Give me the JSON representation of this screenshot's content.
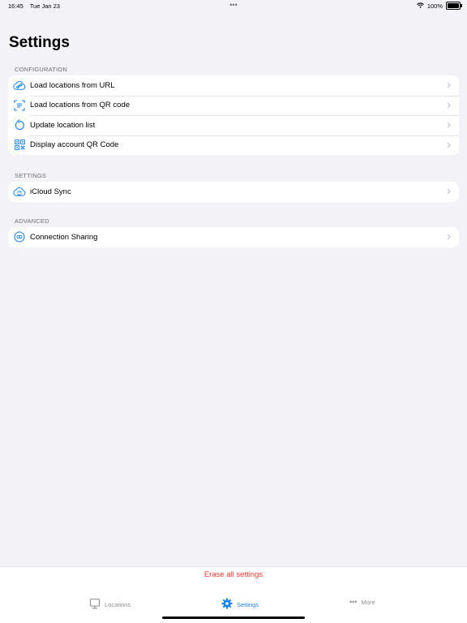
{
  "status_bar": {
    "time": "16:45",
    "date": "Tue Jan 23",
    "battery": "100%",
    "battery_level": 1.0
  },
  "page_title": "Settings",
  "sections": {
    "configuration": {
      "header": "CONFIGURATION",
      "items": [
        {
          "label": "Load locations from URL",
          "icon": "link-icon"
        },
        {
          "label": "Load locations from QR code",
          "icon": "qr-scan-icon"
        },
        {
          "label": "Update location list",
          "icon": "refresh-icon"
        },
        {
          "label": "Display account QR Code",
          "icon": "qr-code-icon"
        }
      ]
    },
    "settings": {
      "header": "SETTINGS",
      "items": [
        {
          "label": "iCloud Sync",
          "icon": "icloud-sync-icon"
        }
      ]
    },
    "advanced": {
      "header": "ADVANCED",
      "items": [
        {
          "label": "Connection Sharing",
          "icon": "connection-sharing-icon"
        }
      ]
    }
  },
  "erase_label": "Erase all settings",
  "tabs": [
    {
      "label": "Locations",
      "icon": "monitor-icon",
      "active": false
    },
    {
      "label": "Settings",
      "icon": "gear-icon",
      "active": true
    },
    {
      "label": "More",
      "icon": "ellipsis-icon",
      "active": false
    }
  ],
  "colors": {
    "accent": "#1b84f0",
    "destructive": "#ff3b30",
    "background": "#f2f2f7",
    "inactive": "#8e8e93"
  }
}
